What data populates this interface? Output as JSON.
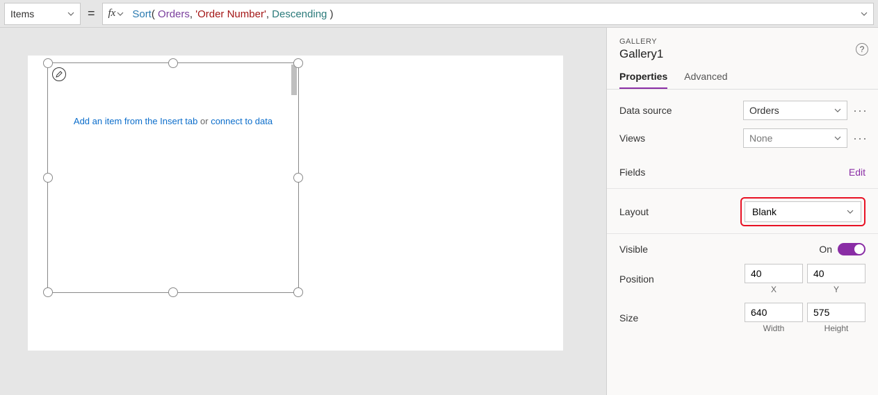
{
  "formula_bar": {
    "property": "Items",
    "fx_label": "fx",
    "tokens": {
      "fn": "Sort",
      "open": "( ",
      "ds": "Orders",
      "c1": ", ",
      "arg": "'Order Number'",
      "c2": ", ",
      "enum": "Descending",
      "close": " )"
    }
  },
  "canvas": {
    "hint_link1": "Add an item from the Insert tab",
    "hint_mid": " or ",
    "hint_link2": "connect to data"
  },
  "panel": {
    "type_label": "GALLERY",
    "name": "Gallery1",
    "tabs": {
      "properties": "Properties",
      "advanced": "Advanced"
    },
    "rows": {
      "data_source": {
        "label": "Data source",
        "value": "Orders"
      },
      "views": {
        "label": "Views",
        "value": "None"
      },
      "fields": {
        "label": "Fields",
        "action": "Edit"
      },
      "layout": {
        "label": "Layout",
        "value": "Blank"
      },
      "visible": {
        "label": "Visible",
        "state": "On"
      },
      "position": {
        "label": "Position",
        "x": "40",
        "y": "40",
        "xlabel": "X",
        "ylabel": "Y"
      },
      "size": {
        "label": "Size",
        "w": "640",
        "h": "575",
        "wlabel": "Width",
        "hlabel": "Height"
      }
    }
  }
}
